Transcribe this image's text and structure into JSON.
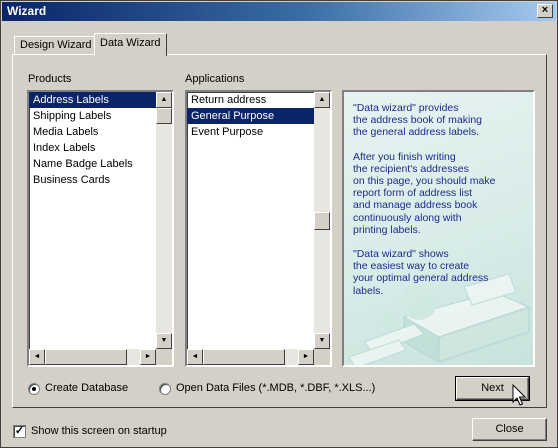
{
  "window": {
    "title": "Wizard",
    "close_glyph": "×"
  },
  "tabs": [
    {
      "label": "Design Wizard",
      "active": false
    },
    {
      "label": "Data Wizard",
      "active": true
    }
  ],
  "products": {
    "label": "Products",
    "items": [
      "Address Labels",
      "Shipping Labels",
      "Media Labels",
      "Index Labels",
      "Name Badge Labels",
      "Business Cards"
    ],
    "selected_index": 0
  },
  "applications": {
    "label": "Applications",
    "items": [
      "Return address",
      "General Purpose",
      "Event Purpose"
    ],
    "selected_index": 1
  },
  "info": {
    "paragraphs": [
      "\"Data wizard\" provides\nthe address book of making\nthe general address labels.",
      "After you finish writing\nthe recipient's addresses\non this page, you should make\nreport form of address list\nand manage address book\ncontinuously along with\nprinting labels.",
      "\"Data wizard\" shows\nthe easiest way to create\nyour optimal general address\nlabels."
    ]
  },
  "options": {
    "create_database": {
      "label": "Create Database",
      "selected": true
    },
    "open_data_files": {
      "label": "Open Data Files (*.MDB, *.DBF, *.XLS...)",
      "selected": false
    }
  },
  "buttons": {
    "next": "Next",
    "close": "Close"
  },
  "startup": {
    "label": "Show this screen on startup",
    "checked": true,
    "check_glyph": "✓"
  },
  "scroll_glyphs": {
    "up": "▲",
    "down": "▼",
    "left": "◄",
    "right": "►"
  },
  "colors": {
    "title_start": "#0a246a",
    "title_end": "#a6caf0",
    "selection": "#0a246a",
    "info_text": "#1c2a8c"
  }
}
